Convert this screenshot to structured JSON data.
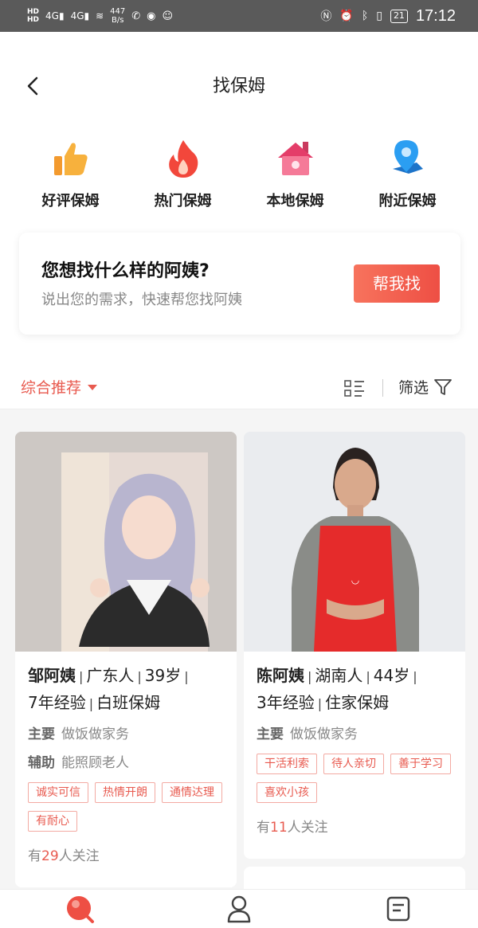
{
  "status_bar": {
    "hd_labels": [
      "HD",
      "HD"
    ],
    "signal_labels": [
      "4G",
      "4G"
    ],
    "net_speed_value": "447",
    "net_speed_unit": "B/s",
    "battery": "21",
    "time": "17:12"
  },
  "header": {
    "title": "找保姆",
    "back_icon": "chevron-left-icon"
  },
  "categories": [
    {
      "label": "好评保姆",
      "icon": "thumbs-up-icon",
      "color": "#f39a2e"
    },
    {
      "label": "热门保姆",
      "icon": "flame-icon",
      "color": "#f2473b"
    },
    {
      "label": "本地保姆",
      "icon": "house-icon",
      "color": "#f2577a"
    },
    {
      "label": "附近保姆",
      "icon": "location-pin-icon",
      "color": "#2b9ef2"
    }
  ],
  "help_card": {
    "title": "您想找什么样的阿姨?",
    "subtitle": "说出您的需求，快速帮您找阿姨",
    "button": "帮我找"
  },
  "filter_bar": {
    "sort_label": "综合推荐",
    "filter_label": "筛选",
    "accent": "#e85a4f"
  },
  "nannies": [
    {
      "name": "邹阿姨",
      "origin": "广东人",
      "age": "39岁",
      "experience": "7年经验",
      "type": "白班保姆",
      "main_label": "主要",
      "main_duty": "做饭做家务",
      "aux_label": "辅助",
      "aux_duty": "能照顾老人",
      "tags": [
        "诚实可信",
        "热情开朗",
        "通情达理",
        "有耐心"
      ],
      "follow_prefix": "有",
      "follow_count": "29",
      "follow_suffix": "人关注"
    },
    {
      "name": "陈阿姨",
      "origin": "湖南人",
      "age": "44岁",
      "experience": "3年经验",
      "type": "住家保姆",
      "main_label": "主要",
      "main_duty": "做饭做家务",
      "tags": [
        "干活利索",
        "待人亲切",
        "善于学习",
        "喜欢小孩"
      ],
      "follow_prefix": "有",
      "follow_count": "11",
      "follow_suffix": "人关注"
    }
  ],
  "tab_bar": {
    "tabs": [
      {
        "icon": "search-icon",
        "active": true
      },
      {
        "icon": "user-icon",
        "active": false
      },
      {
        "icon": "document-icon",
        "active": false
      }
    ]
  }
}
